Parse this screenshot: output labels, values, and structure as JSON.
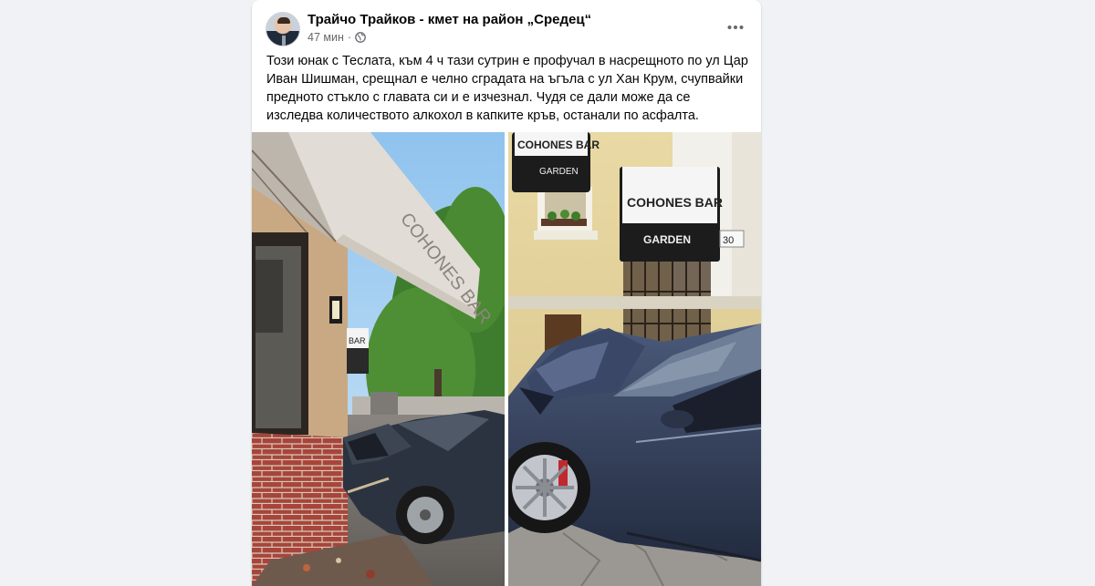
{
  "post": {
    "author": "Трайчо Трайков - кмет на район „Средец“",
    "time": "47 мин",
    "separator": "·",
    "audience_icon": "globe-icon",
    "more_icon": "more-options-icon",
    "text": "Този юнак с Теслата, към 4 ч тази сутрин е профучал в насрещното по ул Цар Иван Шишман, срещнал е челно сградата на ъгъла с ул Хан Крум, счупвайки предното стъкло с главата си и е изчезнал. Чудя се дали може да се изследва количеството алкохол в капките кръв, останали по асфалта."
  },
  "photos": {
    "left": {
      "awning_text": "COHONES BAR",
      "sign_text": "BAR"
    },
    "right": {
      "sign_top_line1": "COHONES BAR",
      "sign_top_line2": "GARDEN",
      "sign_main_line1": "COHONES BAR",
      "sign_main_line2": "GARDEN",
      "house_number": "30"
    }
  },
  "colors": {
    "page_bg": "#f0f2f5",
    "card_bg": "#ffffff",
    "text_primary": "#050505",
    "text_secondary": "#65676b"
  }
}
